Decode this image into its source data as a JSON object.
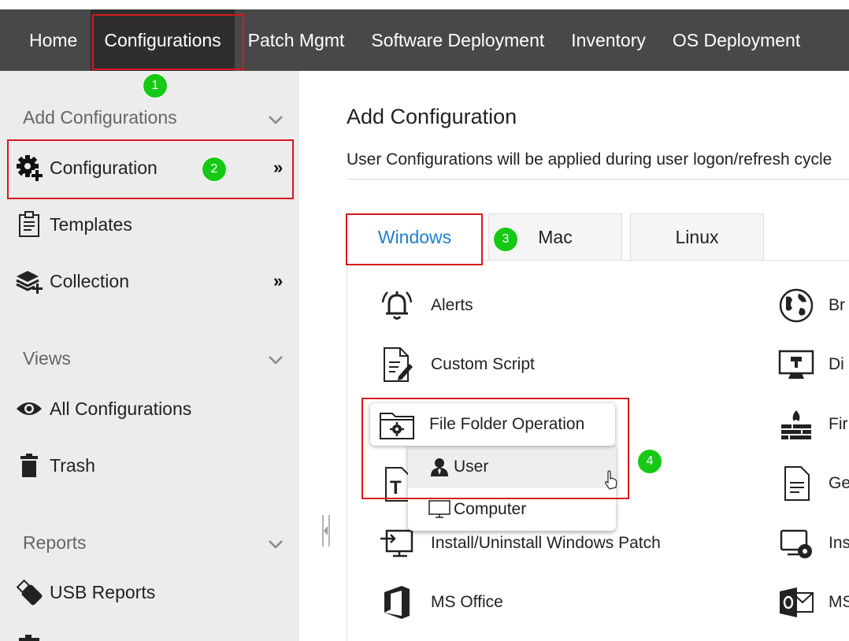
{
  "topnav": {
    "items": [
      "Home",
      "Configurations",
      "Patch Mgmt",
      "Software Deployment",
      "Inventory",
      "OS Deployment"
    ]
  },
  "badges": [
    "1",
    "2",
    "3",
    "4"
  ],
  "sidebar": {
    "add_configurations": {
      "title": "Add Configurations",
      "items": [
        {
          "label": "Configuration",
          "icon": "gear-plus-icon"
        },
        {
          "label": "Templates",
          "icon": "clipboard-icon"
        },
        {
          "label": "Collection",
          "icon": "stack-plus-icon"
        }
      ]
    },
    "views": {
      "title": "Views",
      "items": [
        {
          "label": "All Configurations",
          "icon": "eye-icon"
        },
        {
          "label": "Trash",
          "icon": "trash-icon"
        }
      ]
    },
    "reports": {
      "title": "Reports",
      "items": [
        {
          "label": "USB Reports",
          "icon": "usb-icon"
        }
      ]
    }
  },
  "main": {
    "title": "Add Configuration",
    "description": "User Configurations will be applied during user logon/refresh cycle",
    "tabs": [
      "Windows",
      "Mac",
      "Linux"
    ],
    "active_tab": "Windows",
    "left_items": [
      {
        "label": "Alerts",
        "icon": "bell-icon"
      },
      {
        "label": "Custom Script",
        "icon": "script-edit-icon"
      },
      {
        "label": "File Folder Operation",
        "icon": "folder-gear-icon"
      },
      {
        "label": "",
        "icon": "text-file-icon"
      },
      {
        "label": "Install/Uninstall Windows Patch",
        "icon": "install-patch-icon"
      },
      {
        "label": "MS Office",
        "icon": "ms-office-icon"
      }
    ],
    "right_items": [
      {
        "label": "Br",
        "icon": "globe-icon"
      },
      {
        "label": "Di",
        "icon": "display-icon"
      },
      {
        "label": "Fir",
        "icon": "firewall-icon"
      },
      {
        "label": "Ge",
        "icon": "document-icon"
      },
      {
        "label": "Ins",
        "icon": "install-disk-icon"
      },
      {
        "label": "MS",
        "icon": "ms-outlook-icon"
      }
    ]
  },
  "popup": {
    "title": "File Folder Operation",
    "options": [
      "User",
      "Computer"
    ],
    "hovered": "User"
  },
  "colors": {
    "nav_bg": "#484848",
    "nav_active_bg": "#2e2e2e",
    "sidebar_bg": "#ececec",
    "accent_blue": "#1e7fd1",
    "highlight_red": "#d6181f",
    "badge_green": "#17c917"
  }
}
